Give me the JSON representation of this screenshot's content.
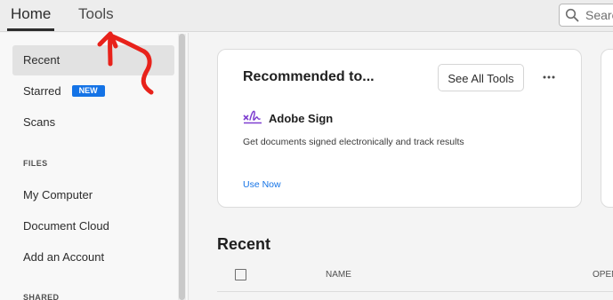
{
  "tabs": [
    {
      "label": "Home"
    },
    {
      "label": "Tools"
    }
  ],
  "search": {
    "placeholder": "Search"
  },
  "sidebar": {
    "items": [
      {
        "label": "Recent"
      },
      {
        "label": "Starred",
        "badge": "NEW"
      },
      {
        "label": "Scans"
      }
    ],
    "files_heading": "FILES",
    "file_items": [
      {
        "label": "My Computer"
      },
      {
        "label": "Document Cloud"
      },
      {
        "label": "Add an Account"
      }
    ],
    "shared_heading": "SHARED"
  },
  "recommended": {
    "title": "Recommended to...",
    "see_all_label": "See All Tools",
    "tool": {
      "name": "Adobe Sign",
      "description": "Get documents signed electronically and track results",
      "action": "Use Now",
      "icon": "adobe-sign-icon"
    }
  },
  "recent": {
    "title": "Recent",
    "columns": [
      "NAME",
      "OPENED"
    ]
  },
  "colors": {
    "accent": "#1473e6",
    "annotation": "#e8221b",
    "sign_purple": "#7e3fd0"
  }
}
